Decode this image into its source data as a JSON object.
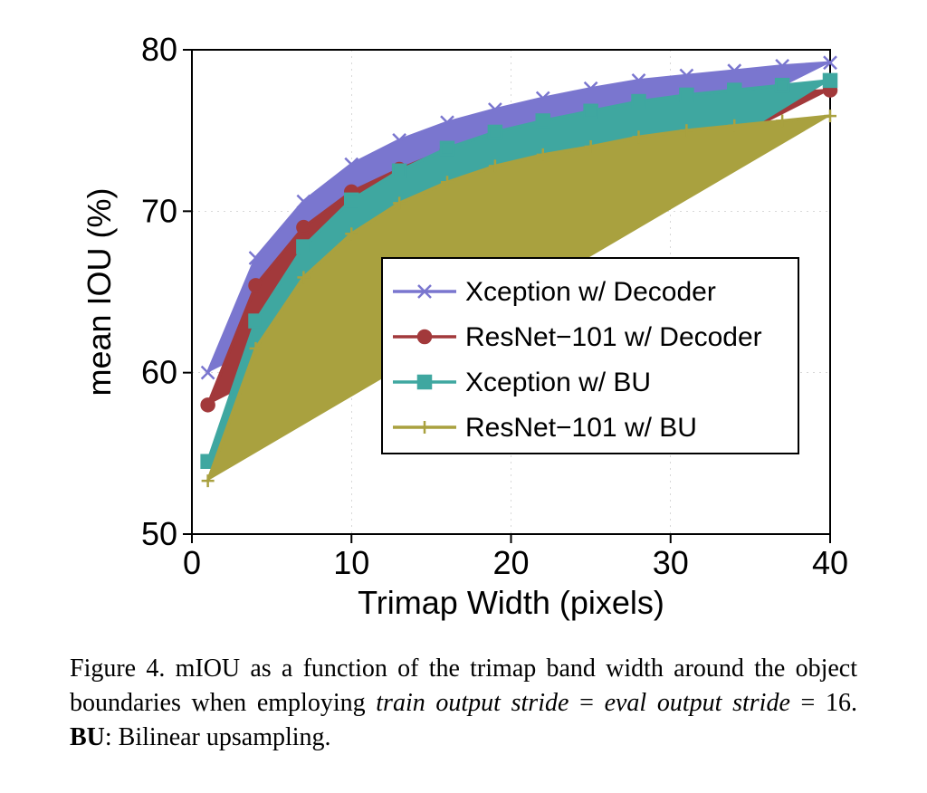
{
  "chart_data": {
    "type": "line",
    "title": "",
    "xlabel": "Trimap Width (pixels)",
    "ylabel": "mean IOU (%)",
    "xlim": [
      0,
      40
    ],
    "ylim": [
      50,
      80
    ],
    "xticks": [
      0,
      10,
      20,
      30,
      40
    ],
    "yticks": [
      50,
      60,
      70,
      80
    ],
    "x": [
      1,
      4,
      7,
      10,
      13,
      16,
      19,
      22,
      25,
      28,
      31,
      34,
      37,
      40
    ],
    "series": [
      {
        "name": "Xception w/ Decoder",
        "marker": "x",
        "color": "#7a76cf",
        "values": [
          60.0,
          67.1,
          70.6,
          72.9,
          74.4,
          75.5,
          76.3,
          77.0,
          77.6,
          78.1,
          78.4,
          78.7,
          79.0,
          79.2
        ]
      },
      {
        "name": "ResNet−101 w/ Decoder",
        "marker": "o",
        "color": "#a2393b",
        "values": [
          58.0,
          65.4,
          69.0,
          71.2,
          72.6,
          73.8,
          74.7,
          75.3,
          75.8,
          76.3,
          76.7,
          77.0,
          77.3,
          77.5
        ]
      },
      {
        "name": "Xception w/ BU",
        "marker": "square",
        "color": "#3fa7a0",
        "values": [
          54.5,
          63.2,
          67.8,
          70.7,
          72.5,
          73.9,
          74.9,
          75.6,
          76.2,
          76.8,
          77.2,
          77.5,
          77.8,
          78.1
        ]
      },
      {
        "name": "ResNet−101 w/ BU",
        "marker": "plus",
        "color": "#a9a13f",
        "values": [
          53.3,
          61.5,
          65.9,
          68.6,
          70.5,
          71.8,
          72.8,
          73.5,
          74.0,
          74.6,
          75.0,
          75.3,
          75.6,
          75.9
        ]
      }
    ],
    "legend_position": "inside-right",
    "grid": true
  },
  "caption": {
    "prefix": "Figure 4.",
    "body_part1": "mIOU as a function of the trimap band width around the object boundaries when employing",
    "ital1": "train output stride",
    "eq1": "=",
    "ital2": "eval output stride",
    "eq2": "= 16.",
    "bu_label": "BU",
    "bu_desc": ": Bilinear upsampling."
  }
}
